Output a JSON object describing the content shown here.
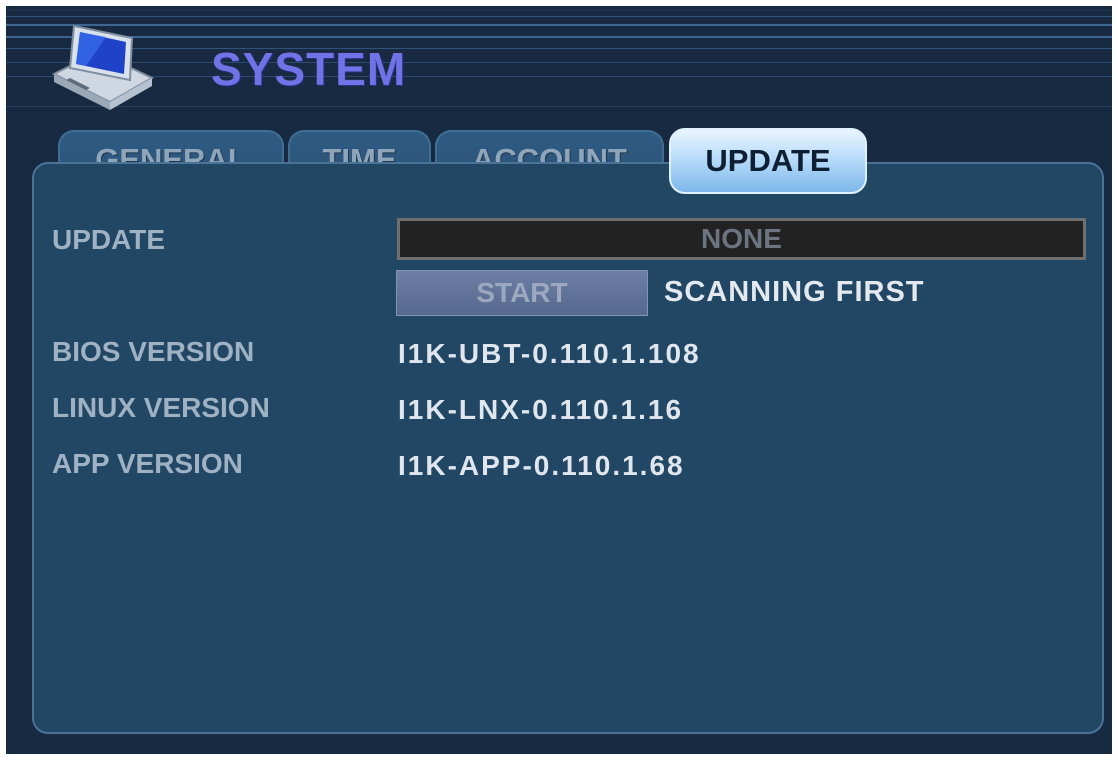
{
  "header": {
    "title": "SYSTEM",
    "icon": "computer-icon"
  },
  "tabs": [
    {
      "label": "GENERAL",
      "active": false
    },
    {
      "label": "TIME",
      "active": false
    },
    {
      "label": "ACCOUNT",
      "active": false
    },
    {
      "label": "UPDATE",
      "active": true
    }
  ],
  "update": {
    "label": "UPDATE",
    "field_value": "NONE",
    "start_label": "START",
    "status": "SCANNING FIRST"
  },
  "versions": [
    {
      "label": "BIOS VERSION",
      "value": "I1K-UBT-0.110.1.108"
    },
    {
      "label": "LINUX VERSION",
      "value": "I1K-LNX-0.110.1.16"
    },
    {
      "label": "APP VERSION",
      "value": "I1K-APP-0.110.1.68"
    }
  ],
  "colors": {
    "background": "#172a41",
    "panel": "#224764",
    "title": "#6f73e6",
    "active_tab": "#b8dcfa"
  }
}
